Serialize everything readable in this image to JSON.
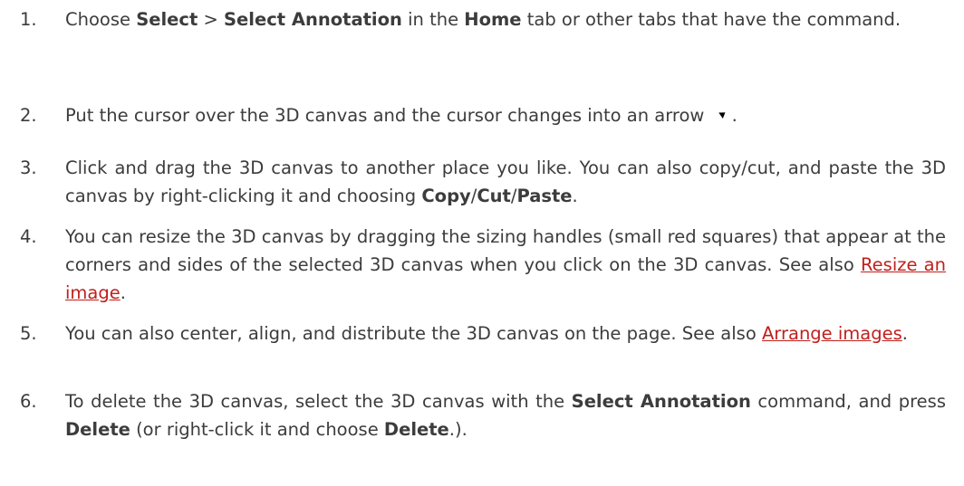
{
  "steps": [
    {
      "num": "1.",
      "parts": {
        "t1": "Choose ",
        "b1": "Select",
        "t2": " > ",
        "b2": "Select Annotation",
        "t3": " in the ",
        "b3": "Home",
        "t4": " tab or other tabs that have the command."
      }
    },
    {
      "num": "2.",
      "parts": {
        "t1": "Put the cursor over the 3D canvas and the cursor changes into an arrow",
        "t2": "."
      },
      "icon": "arrow-cursor-icon"
    },
    {
      "num": "3.",
      "parts": {
        "t1": "Click and drag the 3D canvas to another place you like. You can also copy/cut, and paste the 3D canvas by right-clicking it and choosing ",
        "b1": "Copy",
        "t2": "/",
        "b2": "Cut",
        "t3": "/",
        "b3": "Paste",
        "t4": "."
      }
    },
    {
      "num": "4.",
      "parts": {
        "t1": "You can resize the 3D canvas by dragging the sizing handles (small red squares) that appear at the corners and sides of the selected 3D canvas when you click on the 3D canvas. See also ",
        "link": "Resize an image",
        "t2": "."
      }
    },
    {
      "num": "5.",
      "parts": {
        "t1": "You can also center, align, and distribute the 3D canvas on the page. See also ",
        "link": "Arrange images",
        "t2": "."
      }
    },
    {
      "num": "6.",
      "parts": {
        "t1": "To delete the 3D canvas, select the 3D canvas with the ",
        "b1": "Select Annotation",
        "t2": " command, and press ",
        "b2": "Delete",
        "t3": " (or right-click it and choose ",
        "b3": "Delete",
        "t4": ".)."
      }
    }
  ],
  "colors": {
    "text": "#3c3c3c",
    "link": "#c0201c"
  }
}
